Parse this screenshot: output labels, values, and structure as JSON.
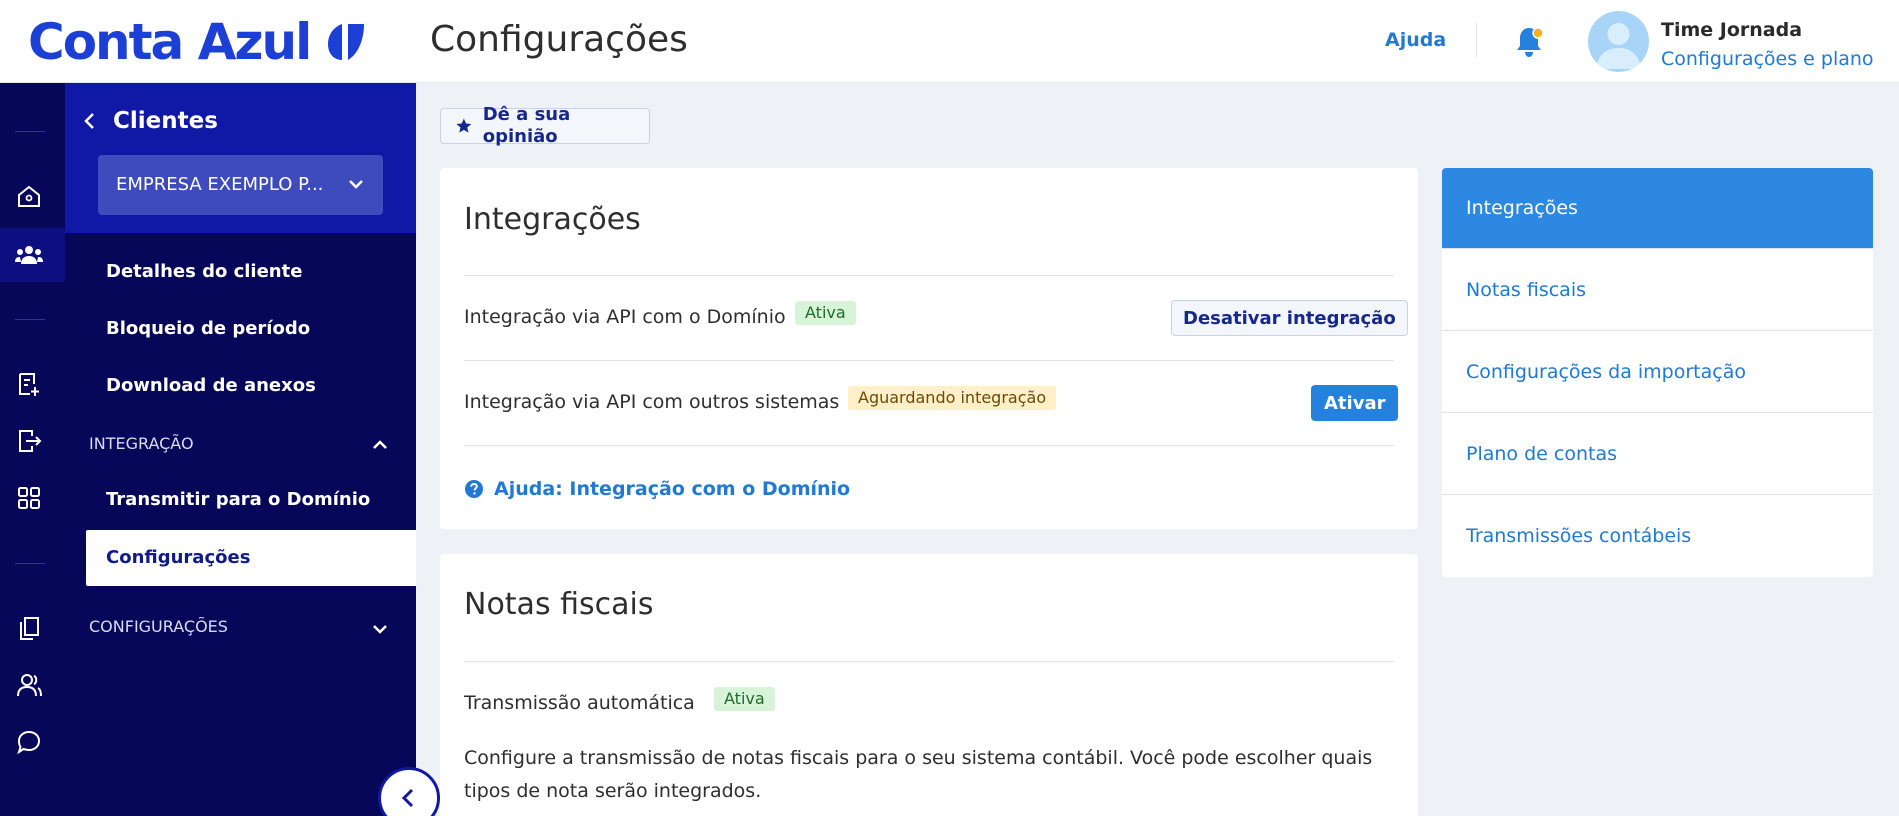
{
  "header": {
    "logo_text": "Conta Azul",
    "page_title": "Configurações",
    "help_label": "Ajuda",
    "user_name": "Time Jornada",
    "user_plan_link": "Configurações e plano"
  },
  "colors": {
    "brand": "#1c3fd6",
    "sidebar_bg": "#07075a",
    "sidebar_top_bg": "#1019a6",
    "accent": "#2482de",
    "link": "#2079d4"
  },
  "rail": {
    "icons": [
      "home-icon",
      "users-icon",
      "invoice-icon",
      "export-icon",
      "apps-icon",
      "documents-icon",
      "person-icon",
      "chat-icon"
    ]
  },
  "sidebar": {
    "back_label": "Clientes",
    "company_selected": "EMPRESA EXEMPLO P...",
    "items": [
      {
        "label": "Detalhes do cliente"
      },
      {
        "label": "Bloqueio de período"
      },
      {
        "label": "Download de anexos"
      }
    ],
    "integration_section": "INTEGRAÇÃO",
    "integration_items": [
      {
        "label": "Transmitir para o Domínio"
      },
      {
        "label": "Configurações"
      }
    ],
    "config_section": "CONFIGURAÇÕES"
  },
  "feedback_label": "Dê a sua opinião",
  "integrations_card": {
    "title": "Integrações",
    "rows": [
      {
        "label": "Integração via API com o Domínio",
        "badge": "Ativa",
        "button": "Desativar integração"
      },
      {
        "label": "Integração via API com outros sistemas",
        "badge": "Aguardando integração",
        "button": "Ativar"
      }
    ],
    "help_link": "Ajuda: Integração com o Domínio"
  },
  "invoices_card": {
    "title": "Notas fiscais",
    "row_label": "Transmissão automática",
    "badge": "Ativa",
    "description": "Configure a transmissão de notas fiscais para o seu sistema contábil. Você pode escolher quais tipos de nota serão integrados."
  },
  "right_nav": {
    "items": [
      {
        "label": "Integrações"
      },
      {
        "label": "Notas fiscais"
      },
      {
        "label": "Configurações da importação"
      },
      {
        "label": "Plano de contas"
      },
      {
        "label": "Transmissões contábeis"
      }
    ]
  }
}
